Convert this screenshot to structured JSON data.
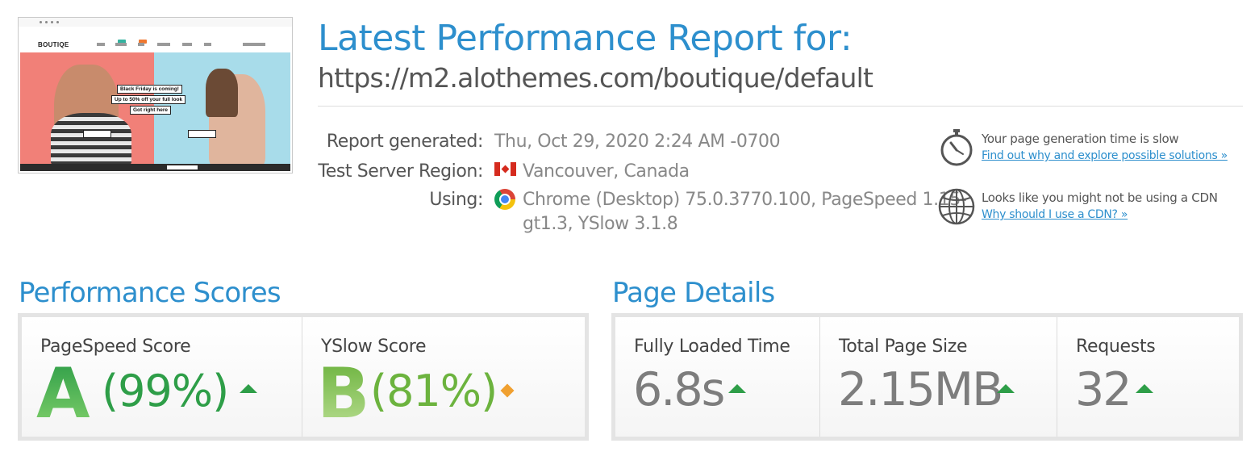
{
  "thumbnail": {
    "site_logo": "BOUTIQE",
    "promo_line1": "Black Friday is coming!",
    "promo_line2": "Up to 50% off your full look",
    "promo_line3": "Got right here"
  },
  "header": {
    "title": "Latest Performance Report for:",
    "url": "https://m2.alothemes.com/boutique/default"
  },
  "report": {
    "generated_label": "Report generated:",
    "generated_value": "Thu, Oct 29, 2020 2:24 AM -0700",
    "region_label": "Test Server Region:",
    "region_value": "Vancouver, Canada",
    "using_label": "Using:",
    "using_value_line1": "Chrome (Desktop) 75.0.3770.100, PageSpeed 1.15-",
    "using_value_line2": "gt1.3, YSlow 3.1.8"
  },
  "notices": [
    {
      "icon": "stopwatch-icon",
      "text": "Your page generation time is slow",
      "link": "Find out why and explore possible solutions »"
    },
    {
      "icon": "globe-icon",
      "text": "Looks like you might not be using a CDN",
      "link": "Why should I use a CDN? »"
    }
  ],
  "performance_scores": {
    "title": "Performance Scores",
    "pagespeed": {
      "label": "PageSpeed Score",
      "grade": "A",
      "percent": "(99%)",
      "trend": "up",
      "color": "#2e9e48"
    },
    "yslow": {
      "label": "YSlow Score",
      "grade": "B",
      "percent": "(81%)",
      "trend": "neutral",
      "color": "#6cb33e"
    }
  },
  "page_details": {
    "title": "Page Details",
    "fully_loaded": {
      "label": "Fully Loaded Time",
      "value": "6.8s",
      "trend": "up"
    },
    "page_size": {
      "label": "Total Page Size",
      "value": "2.15MB",
      "trend": "up"
    },
    "requests": {
      "label": "Requests",
      "value": "32",
      "trend": "up"
    }
  },
  "colors": {
    "accent": "#2d8fcd",
    "good": "#2e9e48",
    "warning": "#f0a030"
  }
}
